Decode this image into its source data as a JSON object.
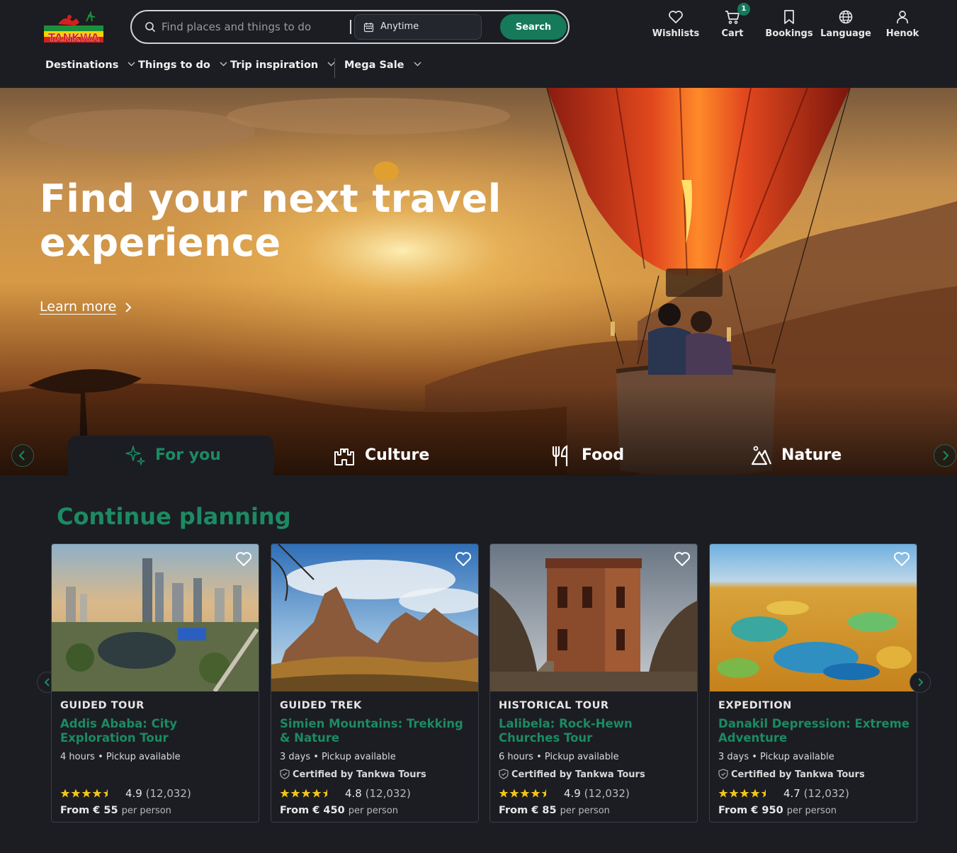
{
  "header": {
    "logo_text": "TANKWA",
    "search": {
      "placeholder": "Find places and things to do",
      "date_value": "Anytime",
      "button_label": "Search"
    },
    "nav": [
      {
        "label": "Wishlists",
        "icon": "heart-icon"
      },
      {
        "label": "Cart",
        "icon": "cart-icon",
        "badge": "1"
      },
      {
        "label": "Bookings",
        "icon": "bookmark-icon"
      },
      {
        "label": "Language",
        "icon": "globe-icon"
      },
      {
        "label": "Henok",
        "icon": "user-icon"
      }
    ],
    "menu": [
      {
        "label": "Destinations"
      },
      {
        "label": "Things to do"
      },
      {
        "label": "Trip inspiration"
      },
      {
        "label": "Mega Sale"
      }
    ]
  },
  "hero": {
    "title": "Find your next travel experience",
    "link_label": "Learn more",
    "categories": [
      {
        "label": "For you",
        "icon": "sparkles-icon",
        "active": true
      },
      {
        "label": "Culture",
        "icon": "castle-icon"
      },
      {
        "label": "Food",
        "icon": "utensils-icon"
      },
      {
        "label": "Nature",
        "icon": "mountain-icon"
      }
    ]
  },
  "continue_planning": {
    "title": "Continue planning",
    "cards": [
      {
        "category": "GUIDED TOUR",
        "title": "Addis Ababa: City Exploration Tour",
        "meta": "4 hours • Pickup available",
        "certified": "",
        "rating": "4.9",
        "reviews": "(12,032)",
        "price": "From € 55",
        "per": "per person"
      },
      {
        "category": "GUIDED TREK",
        "title": "Simien Mountains: Trekking & Nature",
        "meta": "3 days • Pickup available",
        "certified": "Certified by Tankwa Tours",
        "rating": "4.8",
        "reviews": "(12,032)",
        "price": "From € 450",
        "per": "per person"
      },
      {
        "category": "HISTORICAL TOUR",
        "title": "Lalibela: Rock-Hewn Churches Tour",
        "meta": "6 hours • Pickup available",
        "certified": "Certified by Tankwa Tours",
        "rating": "4.9",
        "reviews": "(12,032)",
        "price": "From € 85",
        "per": "per person"
      },
      {
        "category": "EXPEDITION",
        "title": "Danakil Depression: Extreme Adventure",
        "meta": "3 days • Pickup available",
        "certified": "Certified by Tankwa Tours",
        "rating": "4.7",
        "reviews": "(12,032)",
        "price": "From € 950",
        "per": "per person"
      }
    ]
  },
  "colors": {
    "accent": "#15795a",
    "accent_text": "#1c8a62",
    "background": "#1b1d22",
    "star": "#f5c518"
  }
}
